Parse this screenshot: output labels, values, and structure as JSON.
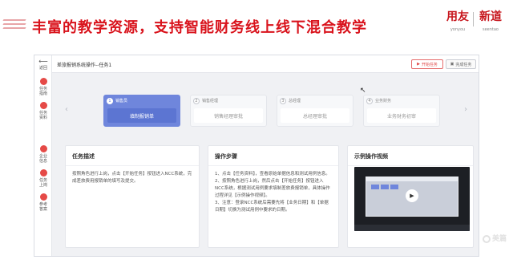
{
  "slide": {
    "title": "丰富的教学资源，支持智能财务线上线下混合教学",
    "logo_primary": "用友",
    "logo_primary_sub": "yonyou",
    "logo_secondary": "新道",
    "logo_secondary_sub": "seentao",
    "watermark": "美篇",
    "accent_color": "#d9131c"
  },
  "sidebar": {
    "back_label": "返回",
    "items": [
      {
        "label": "任务\n指南",
        "icon": "task-guide-icon"
      },
      {
        "label": "任务\n资料",
        "icon": "task-material-icon"
      },
      {
        "label": "企业\n信息",
        "icon": "enterprise-info-icon"
      },
      {
        "label": "任务\n上岗",
        "icon": "task-onduty-icon"
      },
      {
        "label": "参考\n答案",
        "icon": "answer-icon"
      }
    ]
  },
  "header": {
    "breadcrumb": "差旅报销系统操作--任务1",
    "start_button": "开始任务",
    "done_button": "完成任务"
  },
  "steps": [
    {
      "num": "1",
      "role": "销售员",
      "action": "填制报销单",
      "active": true
    },
    {
      "num": "2",
      "role": "销售经理",
      "action": "销售经理审批",
      "active": false
    },
    {
      "num": "3",
      "role": "总经理",
      "action": "总经理审批",
      "active": false
    },
    {
      "num": "4",
      "role": "业务财务",
      "action": "业务财务初审",
      "active": false
    }
  ],
  "cards": {
    "desc_title": "任务描述",
    "desc_text": "按照角色进行上岗，点击【开始任务】按钮进入NCC系统，完成差旅费用报销单的填写及提交。",
    "steps_title": "操作步骤",
    "steps_text_1": "1、点击【任务资料】，查看原始单据信息和测试用例信息。",
    "steps_text_2": "2、按照角色进行上岗，然后点击【开始任务】按钮进入NCC系统，根据测试用例要求填制差旅费报销单，具体操作过程详见【示例操作视频】。",
    "steps_text_3": "3、注意：登录NCC系统后需要先将【业务日期】和【单据日期】切换为测试用例中要求的日期。",
    "video_title": "示例操作视频"
  }
}
